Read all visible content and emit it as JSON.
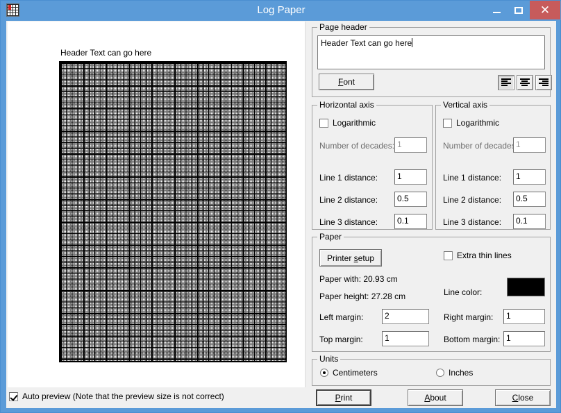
{
  "window": {
    "title": "Log Paper",
    "icon": "grid-paper-icon",
    "minimize": "minimize-icon",
    "maximize": "maximize-icon",
    "close": "close-icon",
    "titlebar_color": "#5b9bd8",
    "close_button_color": "#c75b5b"
  },
  "preview": {
    "header_text": "Header Text can go here",
    "auto_preview_label": "Auto preview (Note that the preview size is not correct)",
    "auto_preview_checked": true
  },
  "page_header": {
    "legend": "Page header",
    "text_value": "Header Text can go here",
    "font_button": "Font",
    "font_button_accel": "F",
    "align_left": "align-left-icon",
    "align_center": "align-center-icon",
    "align_right": "align-right-icon",
    "align_selected": "left"
  },
  "horizontal_axis": {
    "legend": "Horizontal axis",
    "logarithmic_label": "Logarithmic",
    "logarithmic_checked": false,
    "decades_label": "Number of decades:",
    "decades_value": "1",
    "decades_disabled": true,
    "line1_label": "Line 1 distance:",
    "line1_value": "1",
    "line2_label": "Line 2 distance:",
    "line2_value": "0.5",
    "line3_label": "Line 3 distance:",
    "line3_value": "0.1"
  },
  "vertical_axis": {
    "legend": "Vertical axis",
    "logarithmic_label": "Logarithmic",
    "logarithmic_checked": false,
    "decades_label": "Number of decades:",
    "decades_value": "1",
    "decades_disabled": true,
    "line1_label": "Line 1 distance:",
    "line1_value": "1",
    "line2_label": "Line 2 distance:",
    "line2_value": "0.5",
    "line3_label": "Line 3 distance:",
    "line3_value": "0.1"
  },
  "paper": {
    "legend": "Paper",
    "printer_setup_button": "Printer setup",
    "printer_setup_accel": "s",
    "paper_width_text": "Paper with: 20.93 cm",
    "paper_height_text": "Paper height: 27.28 cm",
    "extra_thin_label": "Extra thin lines",
    "extra_thin_checked": false,
    "line_color_label": "Line color:",
    "line_color_value": "#000000",
    "left_margin_label": "Left margin:",
    "left_margin_value": "2",
    "right_margin_label": "Right margin:",
    "right_margin_value": "1",
    "top_margin_label": "Top margin:",
    "top_margin_value": "1",
    "bottom_margin_label": "Bottom margin:",
    "bottom_margin_value": "1"
  },
  "units": {
    "legend": "Units",
    "centimeters_label": "Centimeters",
    "inches_label": "Inches",
    "selected": "Centimeters"
  },
  "actions": {
    "print": "Print",
    "print_accel": "P",
    "about": "About",
    "about_accel": "A",
    "close": "Close",
    "close_accel": "C"
  }
}
